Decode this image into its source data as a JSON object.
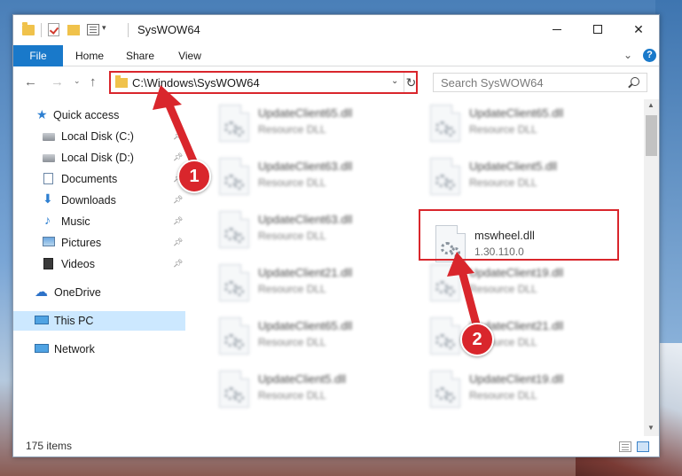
{
  "window": {
    "title": "SysWOW64",
    "controls": {
      "minimize": "—",
      "maximize": "",
      "close": "✕"
    }
  },
  "ribbon": {
    "tabs": [
      "File",
      "Home",
      "Share",
      "View"
    ],
    "help": "?"
  },
  "nav": {
    "address": "C:\\Windows\\SysWOW64",
    "search_placeholder": "Search SysWOW64"
  },
  "sidebar": {
    "items": [
      {
        "label": "Quick access",
        "icon": "star-icon"
      },
      {
        "label": "Local Disk (C:)",
        "icon": "drive-icon",
        "pinned": true
      },
      {
        "label": "Local Disk (D:)",
        "icon": "drive-icon",
        "pinned": true
      },
      {
        "label": "Documents",
        "icon": "documents-icon",
        "pinned": true
      },
      {
        "label": "Downloads",
        "icon": "downloads-icon",
        "pinned": true
      },
      {
        "label": "Music",
        "icon": "music-icon",
        "pinned": true
      },
      {
        "label": "Pictures",
        "icon": "pictures-icon",
        "pinned": true
      },
      {
        "label": "Videos",
        "icon": "videos-icon",
        "pinned": true
      },
      {
        "label": "OneDrive",
        "icon": "onedrive-icon"
      },
      {
        "label": "This PC",
        "icon": "computer-icon",
        "selected": true
      },
      {
        "label": "Network",
        "icon": "network-icon"
      }
    ]
  },
  "files": [
    {
      "name": "UpdateClient65.dll",
      "type": "Resource DLL"
    },
    {
      "name": "UpdateClient65.dll",
      "type": "Resource DLL"
    },
    {
      "name": "UpdateClient63.dll",
      "type": "Resource DLL"
    },
    {
      "name": "UpdateClient5.dll",
      "type": "Resource DLL"
    },
    {
      "name": "UpdateClient63.dll",
      "type": "Resource DLL"
    },
    {
      "name": "mswheel.dll",
      "type": "1.30.110.0",
      "highlighted": true
    },
    {
      "name": "UpdateClient21.dll",
      "type": "Resource DLL"
    },
    {
      "name": "UpdateClient19.dll",
      "type": "Resource DLL"
    },
    {
      "name": "UpdateClient65.dll",
      "type": "Resource DLL"
    },
    {
      "name": "UpdateClient21.dll",
      "type": "Resource DLL"
    },
    {
      "name": "UpdateClient5.dll",
      "type": "Resource DLL"
    },
    {
      "name": "UpdateClient19.dll",
      "type": "Resource DLL"
    }
  ],
  "status": {
    "item_count": "175 items"
  },
  "annotations": {
    "step1": "1",
    "step2": "2",
    "color": "#d9262c"
  }
}
